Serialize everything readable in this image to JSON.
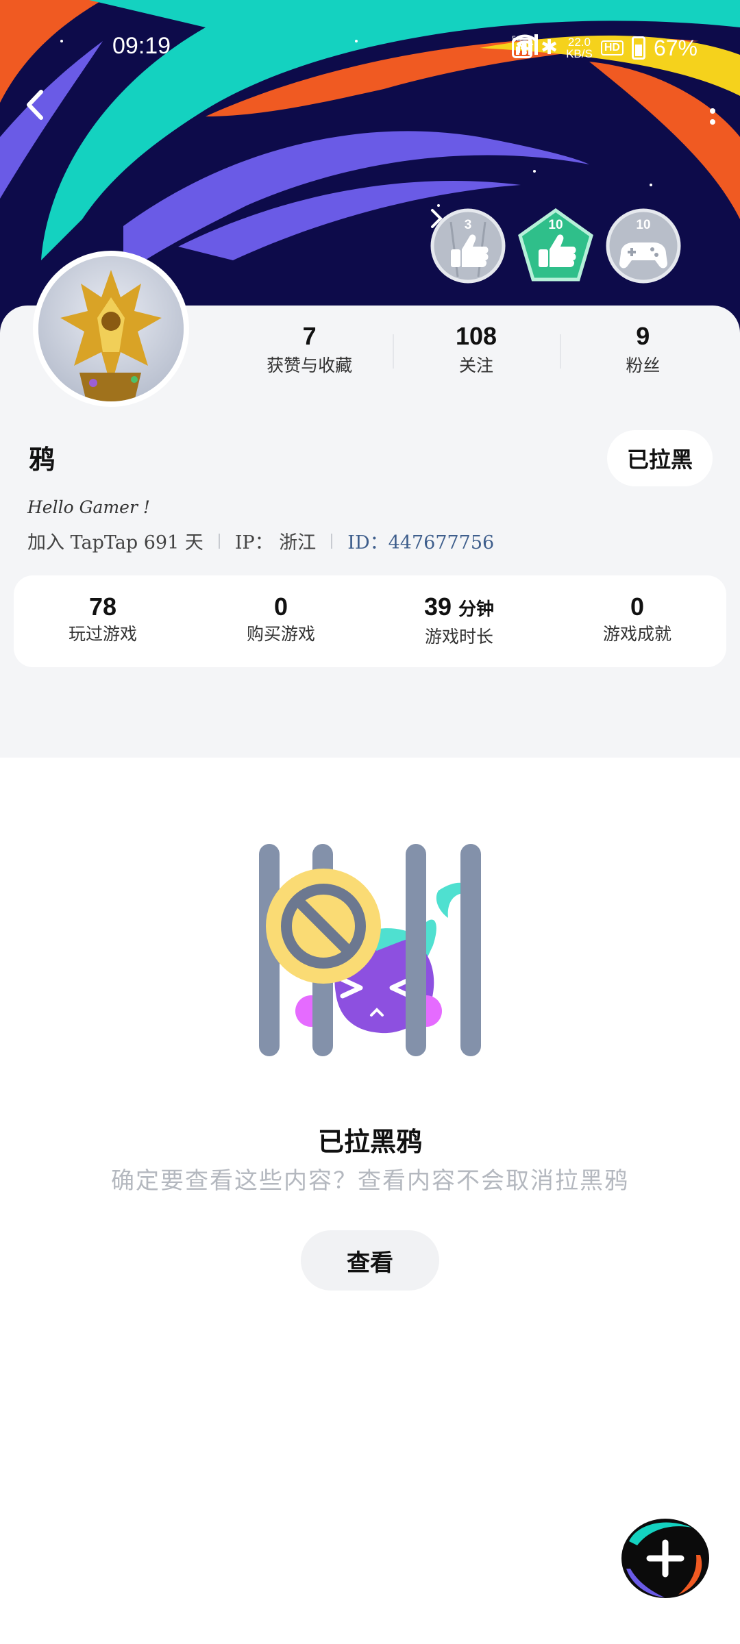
{
  "status_bar": {
    "time": "09:19",
    "network_speed_value": "22.0",
    "network_speed_unit": "KB/S",
    "hd_label": "HD",
    "network_type": "5G",
    "battery": "67%"
  },
  "badges": [
    {
      "number": "3",
      "color": "#b8bec9"
    },
    {
      "number": "10",
      "color": "#2fbf8a"
    },
    {
      "number": "10",
      "color": "#b8bec9"
    }
  ],
  "profile": {
    "stats": [
      {
        "value": "7",
        "label": "获赞与收藏"
      },
      {
        "value": "108",
        "label": "关注"
      },
      {
        "value": "9",
        "label": "粉丝"
      }
    ],
    "username": "鸦",
    "blocked_button_label": "已拉黑",
    "bio": "Hello Gamer !",
    "joined": "加入 TapTap 691 天",
    "ip": "IP： 浙江",
    "id": "ID：447677756"
  },
  "game_stats": [
    {
      "value": "78",
      "unit": "",
      "label": "玩过游戏"
    },
    {
      "value": "0",
      "unit": "",
      "label": "购买游戏"
    },
    {
      "value": "39",
      "unit": "分钟",
      "label": "游戏时长"
    },
    {
      "value": "0",
      "unit": "",
      "label": "游戏成就"
    }
  ],
  "empty_state": {
    "title": "已拉黑鸦",
    "description": "确定要查看这些内容？查看内容不会取消拉黑鸦",
    "view_button_label": "查看"
  },
  "colors": {
    "banner_bg": "#0d0b4a",
    "accent_teal": "#14d2c0",
    "accent_orange": "#f05a22",
    "accent_purple": "#6a5be6",
    "card_bg": "#f4f5f7",
    "id_text": "#3e5e8c"
  }
}
